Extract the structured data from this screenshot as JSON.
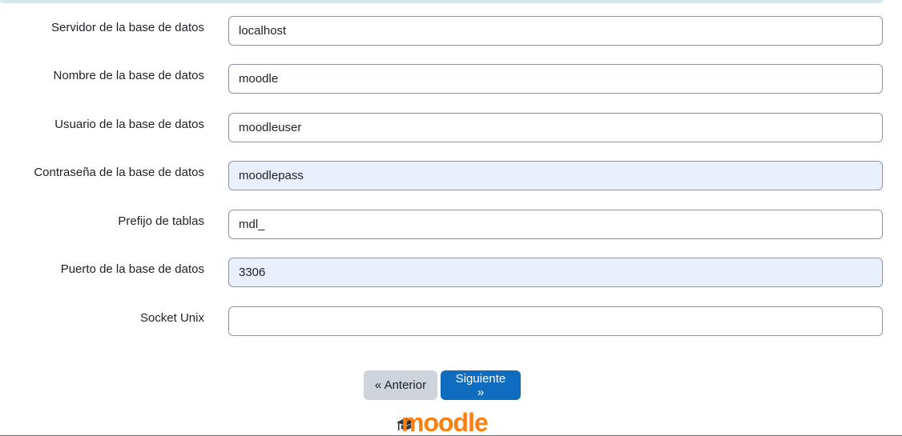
{
  "form": {
    "fields": [
      {
        "label": "Servidor de la base de datos",
        "value": "localhost"
      },
      {
        "label": "Nombre de la base de datos",
        "value": "moodle"
      },
      {
        "label": "Usuario de la base de datos",
        "value": "moodleuser"
      },
      {
        "label": "Contraseña de la base de datos",
        "value": "moodlepass"
      },
      {
        "label": "Prefijo de tablas",
        "value": "mdl_"
      },
      {
        "label": "Puerto de la base de datos",
        "value": "3306"
      },
      {
        "label": "Socket Unix",
        "value": ""
      }
    ]
  },
  "buttons": {
    "prev_label": "« Anterior",
    "next_label": "Siguiente »"
  },
  "footer": {
    "logo_text": "moodle"
  },
  "colors": {
    "accent": "#0f6cbf",
    "secondary_button": "#ced4da",
    "autofill_bg": "#e8f0fe",
    "logo_orange": "#f98012",
    "top_strip": "#d4e7ea"
  },
  "icons": {
    "logo_hat": "mortarboard-icon"
  }
}
